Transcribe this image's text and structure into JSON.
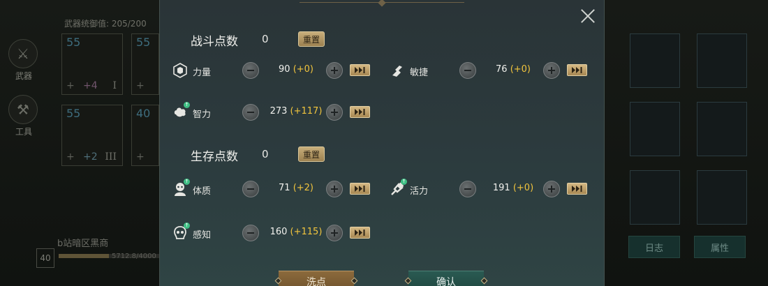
{
  "background": {
    "stat_line": "武器统御值:   205/200",
    "side_nav": [
      {
        "label": "武器",
        "icon": "weapon-icon"
      },
      {
        "label": "工具",
        "icon": "tool-icon"
      }
    ],
    "slots": [
      {
        "level": "55",
        "plus": "+",
        "bonus": "+4",
        "tier": "I"
      },
      {
        "level": "55",
        "plus": "+",
        "bonus": "",
        "tier": ""
      },
      {
        "level": "55",
        "plus": "+",
        "bonus": "+2",
        "tier": "III"
      },
      {
        "level": "40",
        "plus": "+",
        "bonus": "",
        "tier": ""
      }
    ],
    "region_name": "b站暗区黑商",
    "region_level": "40",
    "region_value": "5712.8/4000",
    "region_progress": 0.5,
    "right_tabs": [
      {
        "label": "日志"
      },
      {
        "label": "属性"
      }
    ]
  },
  "modal": {
    "combat": {
      "title": "战斗点数",
      "points": "0",
      "reset_label": "重置",
      "stats": [
        {
          "name": "力量",
          "icon": "strength-icon",
          "base": "90",
          "delta": "(+0)"
        },
        {
          "name": "敏捷",
          "icon": "agility-icon",
          "base": "76",
          "delta": "(+0)"
        },
        {
          "name": "智力",
          "icon": "intellect-icon",
          "base": "273",
          "delta": "(+117)"
        }
      ]
    },
    "survival": {
      "title": "生存点数",
      "points": "0",
      "reset_label": "重置",
      "stats": [
        {
          "name": "体质",
          "icon": "constitution-icon",
          "base": "71",
          "delta": "(+2)"
        },
        {
          "name": "活力",
          "icon": "vitality-icon",
          "base": "191",
          "delta": "(+0)"
        },
        {
          "name": "感知",
          "icon": "perception-icon",
          "base": "160",
          "delta": "(+115)"
        }
      ]
    },
    "wash_label": "洗点",
    "confirm_label": "确认",
    "colors": {
      "delta": "#f2c53d",
      "upgrade_badge": "#3fbf84",
      "reset_button": "#b39667"
    }
  }
}
